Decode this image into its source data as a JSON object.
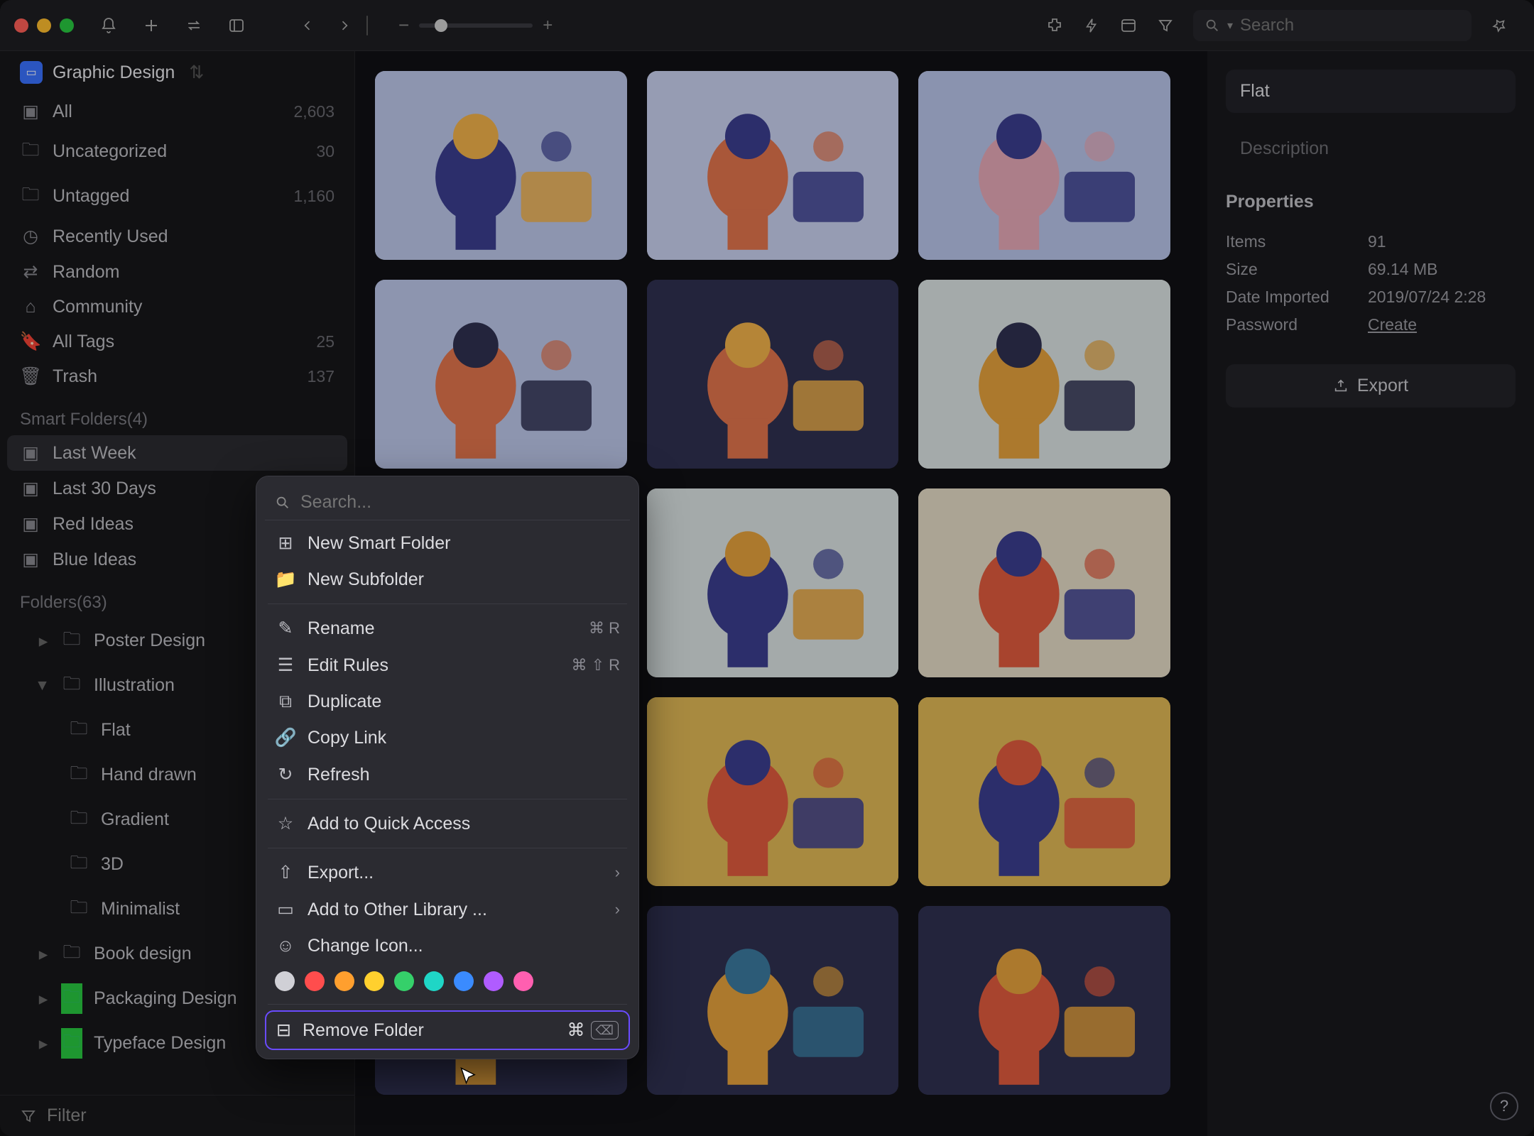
{
  "library_name": "Graphic Design",
  "search_placeholder": "Search",
  "sidebar": {
    "quick": [
      {
        "icon": "all",
        "label": "All",
        "count": "2,603"
      },
      {
        "icon": "uncat",
        "label": "Uncategorized",
        "count": "30"
      },
      {
        "icon": "untag",
        "label": "Untagged",
        "count": "1,160"
      },
      {
        "icon": "recent",
        "label": "Recently Used",
        "count": ""
      },
      {
        "icon": "random",
        "label": "Random",
        "count": ""
      },
      {
        "icon": "community",
        "label": "Community",
        "count": ""
      },
      {
        "icon": "tags",
        "label": "All Tags",
        "count": "25"
      },
      {
        "icon": "trash",
        "label": "Trash",
        "count": "137"
      }
    ],
    "smart_header": "Smart Folders(4)",
    "smart": [
      {
        "label": "Last Week",
        "active": true
      },
      {
        "label": "Last 30 Days"
      },
      {
        "label": "Red Ideas"
      },
      {
        "label": "Blue Ideas"
      }
    ],
    "folders_header": "Folders(63)",
    "folders": [
      {
        "label": "Poster Design",
        "tri": "right",
        "color": "orange"
      },
      {
        "label": "Illustration",
        "tri": "down",
        "color": "orange"
      },
      {
        "label": "Flat",
        "indent": 2,
        "color": "orange",
        "selected": true
      },
      {
        "label": "Hand drawn",
        "indent": 2,
        "color": "orange"
      },
      {
        "label": "Gradient",
        "indent": 2,
        "color": "orange"
      },
      {
        "label": "3D",
        "indent": 2,
        "color": "orange"
      },
      {
        "label": "Minimalist",
        "indent": 2,
        "color": "orange"
      },
      {
        "label": "Book design",
        "tri": "right",
        "color": "orange"
      },
      {
        "label": "Packaging Design",
        "tri": "right",
        "color": "green"
      },
      {
        "label": "Typeface Design",
        "tri": "right",
        "color": "green"
      }
    ],
    "filter_label": "Filter"
  },
  "ctx": {
    "search_placeholder": "Search...",
    "new_smart": "New Smart Folder",
    "new_sub": "New Subfolder",
    "rename": "Rename",
    "rename_shc": "⌘ R",
    "edit_rules": "Edit Rules",
    "edit_rules_shc": "⌘ ⇧ R",
    "duplicate": "Duplicate",
    "copy_link": "Copy Link",
    "refresh": "Refresh",
    "quick_access": "Add to Quick Access",
    "export": "Export...",
    "other_lib": "Add to Other Library ...",
    "change_icon": "Change Icon...",
    "colors": [
      "#d0d0d6",
      "#ff4d4d",
      "#ff9f2e",
      "#ffd02e",
      "#35d06a",
      "#1fd6c6",
      "#3a8bff",
      "#b05cff",
      "#ff5fb0"
    ],
    "remove": "Remove Folder",
    "remove_shc": "⌘"
  },
  "detail": {
    "title": "Flat",
    "desc_placeholder": "Description",
    "props_header": "Properties",
    "rows": [
      {
        "k": "Items",
        "v": "91"
      },
      {
        "k": "Size",
        "v": "69.14 MB"
      },
      {
        "k": "Date Imported",
        "v": "2019/07/24 2:28"
      },
      {
        "k": "Password",
        "v": "Create",
        "link": true
      }
    ],
    "export": "Export"
  }
}
